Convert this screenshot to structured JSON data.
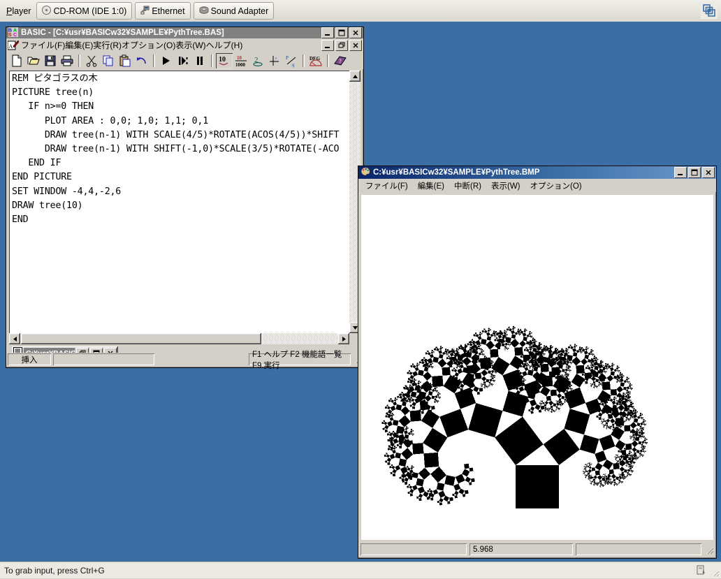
{
  "vmware": {
    "player_menu": "Player",
    "devices": [
      {
        "label": "CD-ROM (IDE 1:0)",
        "icon": "cdrom-icon"
      },
      {
        "label": "Ethernet",
        "icon": "network-icon"
      },
      {
        "label": "Sound Adapter",
        "icon": "speaker-icon"
      }
    ],
    "logo_icon": "vmware-logo-icon",
    "status_text": "To grab input, press Ctrl+G"
  },
  "desktop": {
    "background_color": "#3a6ea5"
  },
  "basic_window": {
    "title": "BASIC - [C:¥usr¥BASICw32¥SAMPLE¥PythTree.BAS]",
    "app_icon": "basic-app-icon",
    "doc_icon": "document-pen-icon",
    "window_buttons": [
      "minimize",
      "maximize",
      "close"
    ],
    "mdi_buttons": [
      "minimize",
      "restore",
      "close"
    ],
    "menus": [
      {
        "label": "ファイル(F)",
        "accel": "F"
      },
      {
        "label": "編集(E)",
        "accel": "E"
      },
      {
        "label": "実行(R)",
        "accel": "R"
      },
      {
        "label": "オプション(O)",
        "accel": "O"
      },
      {
        "label": "表示(W)",
        "accel": "W"
      },
      {
        "label": "ヘルプ(H)",
        "accel": "H"
      }
    ],
    "toolbar_icons": [
      "new-file-icon",
      "open-folder-icon",
      "save-disk-icon",
      "print-icon",
      "cut-scissors-icon",
      "copy-icon",
      "paste-icon",
      "undo-arrow-icon",
      "run-play-icon",
      "step-icon",
      "pause-icon",
      "decimal-10-icon",
      "fraction-10-1000-icon",
      "radical-2-icon",
      "complex-c-icon",
      "rational-p-q-icon",
      "degree-icon",
      "help-book-icon"
    ],
    "code": "REM ピタゴラスの木\nPICTURE tree(n)\n   IF n>=0 THEN\n      PLOT AREA : 0,0; 1,0; 1,1; 0,1\n      DRAW tree(n-1) WITH SCALE(4/5)*ROTATE(ACOS(4/5))*SHIFT\n      DRAW tree(n-1) WITH SHIFT(-1,0)*SCALE(3/5)*ROTATE(-ACO\n   END IF\nEND PICTURE\nSET WINDOW -4,4,-2,6\nDRAW tree(10)\nEND",
    "status": {
      "insert_mode": "挿入",
      "middle_panel": "",
      "hints": "F1 ヘルプ  F2 機能語一覧  F9 実行"
    },
    "minimized_child": {
      "title": "C:¥usr¥BASIC",
      "icon": "text-document-icon",
      "buttons": [
        "restore",
        "maximize",
        "close"
      ]
    }
  },
  "bmp_window": {
    "title": "C:¥usr¥BASICw32¥SAMPLE¥PythTree.BMP",
    "app_icon": "paint-palette-icon",
    "window_buttons": [
      "minimize",
      "maximize",
      "close"
    ],
    "menus": [
      {
        "label": "ファイル(F)",
        "accel": "F"
      },
      {
        "label": "編集(E)",
        "accel": "E"
      },
      {
        "label": "中断(R)",
        "accel": "R"
      },
      {
        "label": "表示(W)",
        "accel": "W"
      },
      {
        "label": "オプション(O)",
        "accel": "O"
      }
    ],
    "status": {
      "left_panel": "",
      "value_panel": "5.968",
      "right_panel": ""
    },
    "image": {
      "name": "pythagoras-tree-fractal",
      "depth": 10,
      "fill_color": "#000000",
      "background_color": "#ffffff",
      "scale_left": 0.8,
      "scale_right": 0.6
    }
  }
}
